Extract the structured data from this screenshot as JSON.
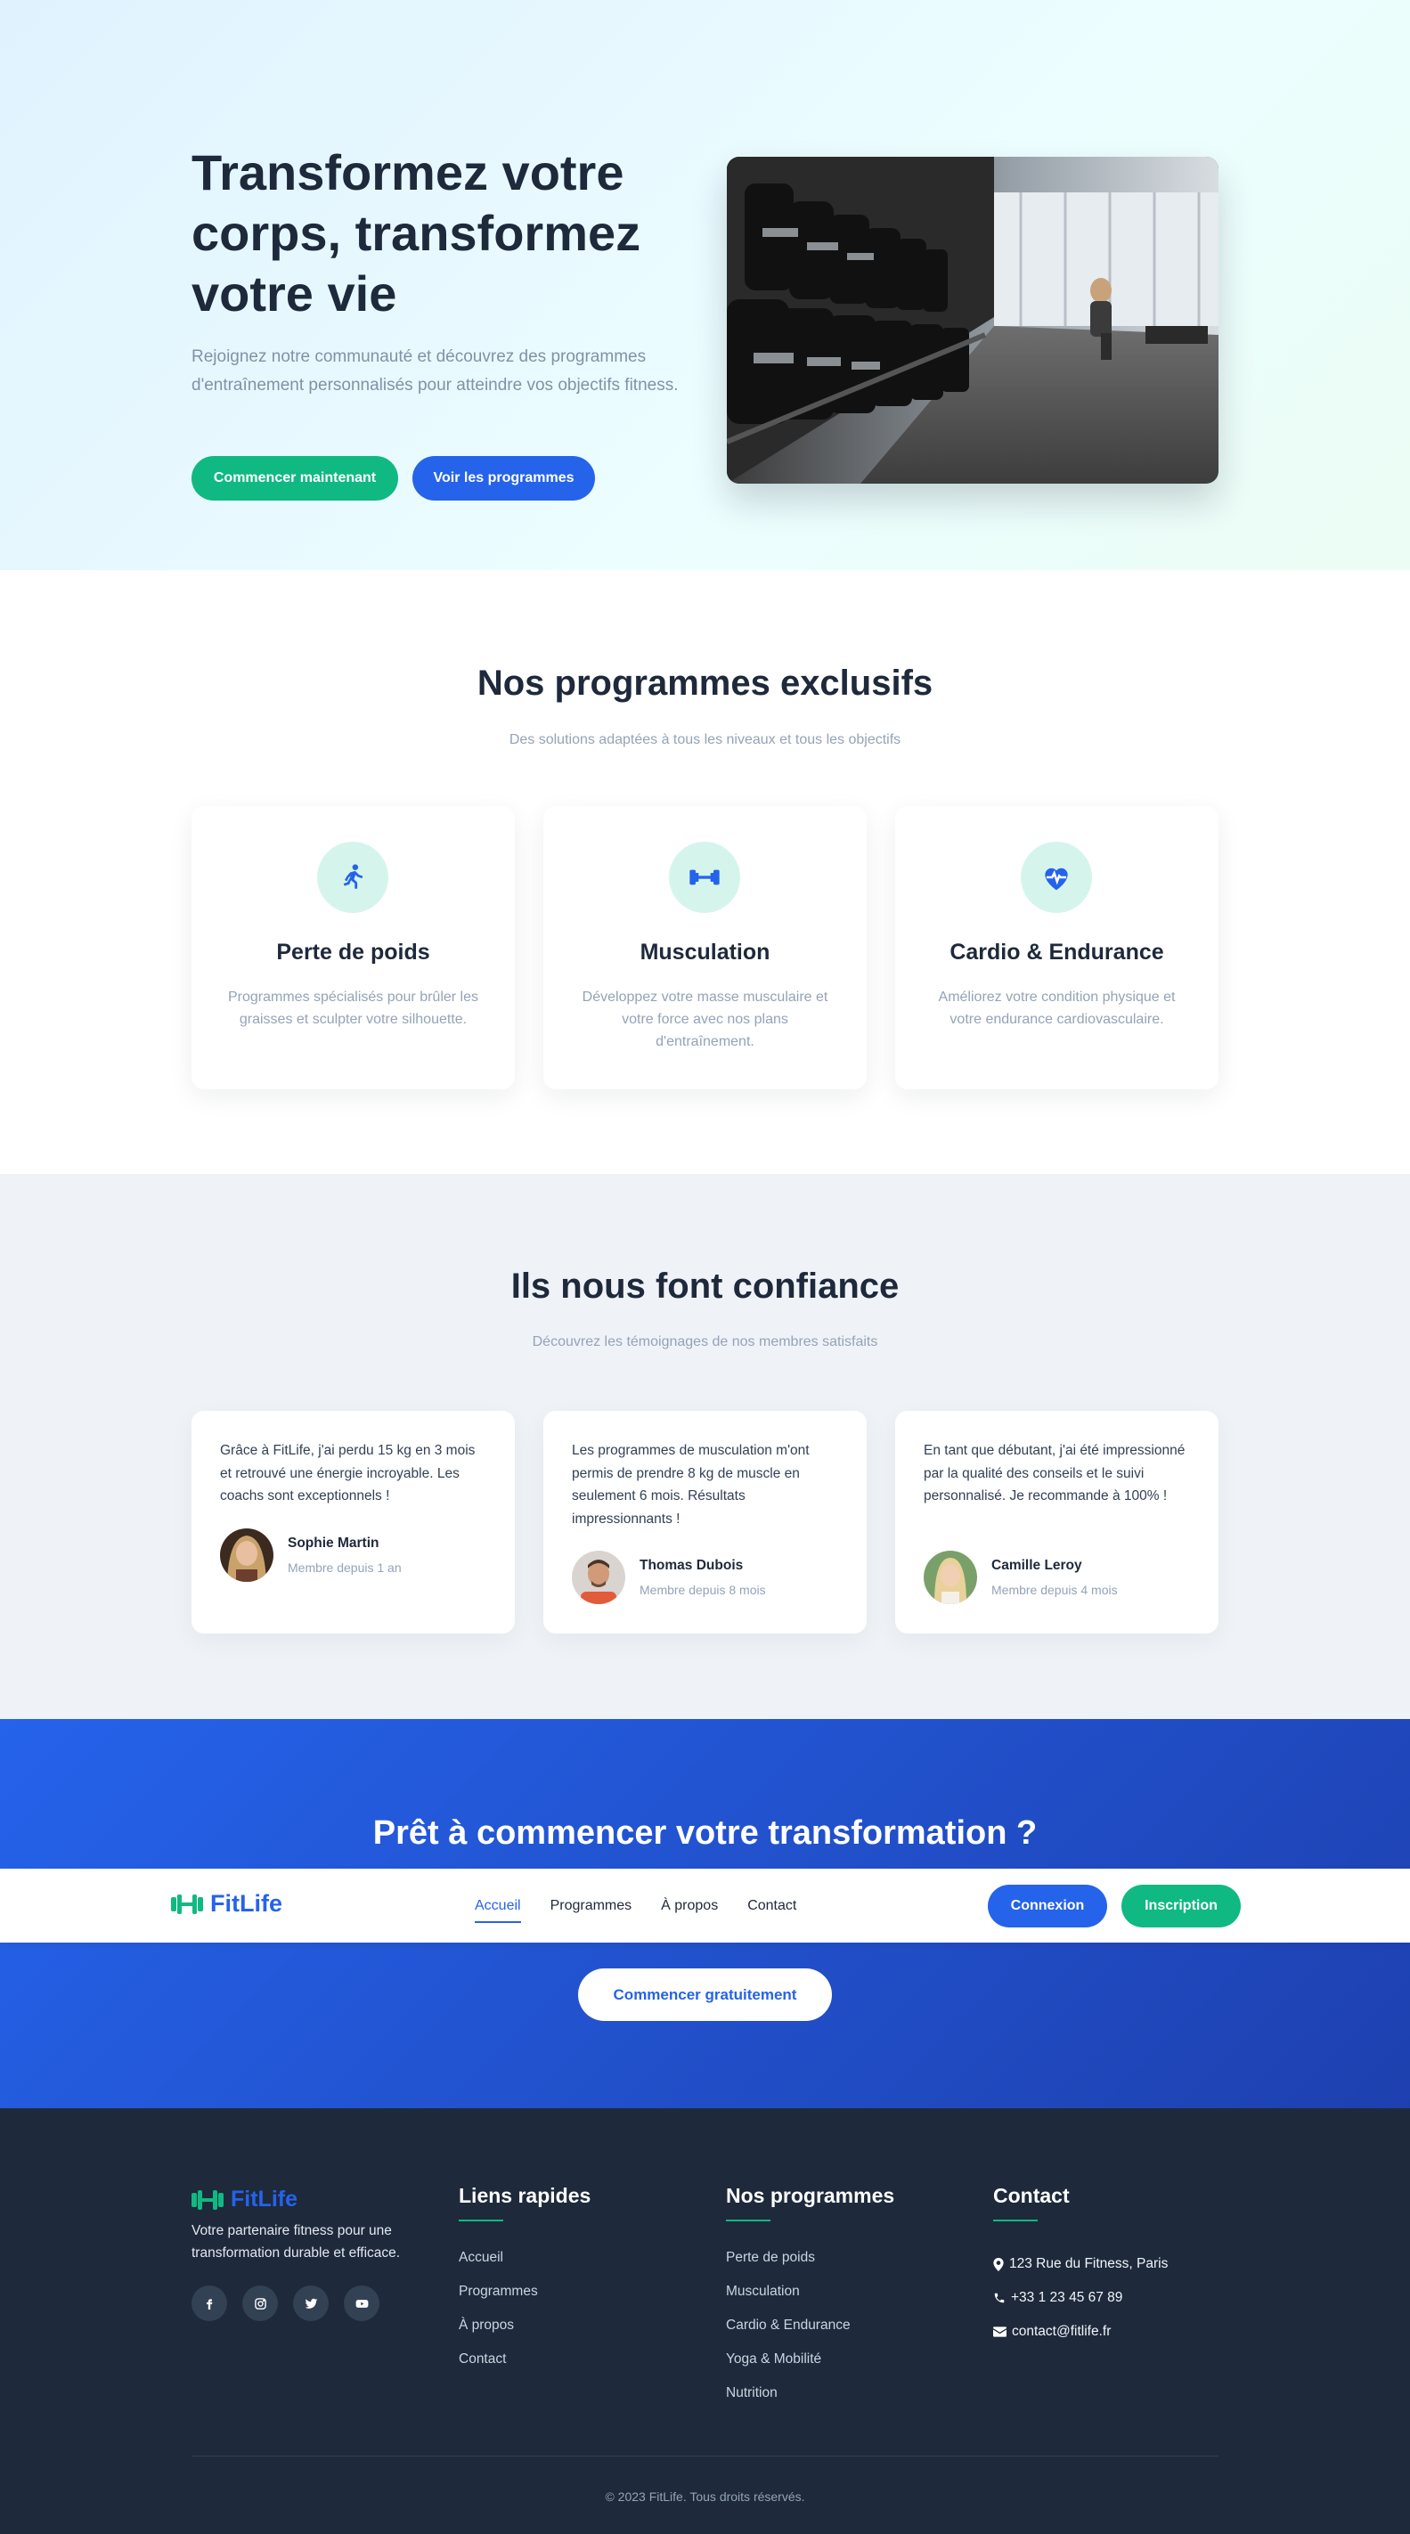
{
  "hero": {
    "title": "Transformez votre corps, transformez votre vie",
    "subtitle": "Rejoignez notre communauté et découvrez des programmes d'entraînement personnalisés pour atteindre vos objectifs fitness.",
    "primary_button": "Commencer maintenant",
    "secondary_button": "Voir les programmes"
  },
  "programs": {
    "title": "Nos programmes exclusifs",
    "subtitle": "Des solutions adaptées à tous les niveaux et tous les objectifs",
    "cards": [
      {
        "icon": "running-icon",
        "title": "Perte de poids",
        "description": "Programmes spécialisés pour brûler les graisses et sculpter votre silhouette."
      },
      {
        "icon": "dumbbell-icon",
        "title": "Musculation",
        "description": "Développez votre masse musculaire et votre force avec nos plans d'entraînement."
      },
      {
        "icon": "heartbeat-icon",
        "title": "Cardio & Endurance",
        "description": "Améliorez votre condition physique et votre endurance cardiovasculaire."
      }
    ]
  },
  "testimonials": {
    "title": "Ils nous font confiance",
    "subtitle": "Découvrez les témoignages de nos membres satisfaits",
    "items": [
      {
        "quote": "Grâce à FitLife, j'ai perdu 15 kg en 3 mois et retrouvé une énergie incroyable. Les coachs sont exceptionnels !",
        "name": "Sophie Martin",
        "since": "Membre depuis 1 an"
      },
      {
        "quote": "Les programmes de musculation m'ont permis de prendre 8 kg de muscle en seulement 6 mois. Résultats impressionnants !",
        "name": "Thomas Dubois",
        "since": "Membre depuis 8 mois"
      },
      {
        "quote": "En tant que débutant, j'ai été impressionné par la qualité des conseils et le suivi personnalisé. Je recommande à 100% !",
        "name": "Camille Leroy",
        "since": "Membre depuis 4 mois"
      }
    ]
  },
  "cta": {
    "title": "Prêt à commencer votre transformation ?",
    "button": "Commencer gratuitement"
  },
  "navbar": {
    "brand": "FitLife",
    "links": [
      "Accueil",
      "Programmes",
      "À propos",
      "Contact"
    ],
    "active": "Accueil",
    "login": "Connexion",
    "signup": "Inscription"
  },
  "footer": {
    "brand": "FitLife",
    "description": "Votre partenaire fitness pour une transformation durable et efficace.",
    "social_icons": [
      "facebook-icon",
      "instagram-icon",
      "twitter-icon",
      "youtube-icon"
    ],
    "quick_links": {
      "title": "Liens rapides",
      "items": [
        "Accueil",
        "Programmes",
        "À propos",
        "Contact"
      ]
    },
    "programs": {
      "title": "Nos programmes",
      "items": [
        "Perte de poids",
        "Musculation",
        "Cardio & Endurance",
        "Yoga & Mobilité",
        "Nutrition"
      ]
    },
    "contact": {
      "title": "Contact",
      "address": "123 Rue du Fitness, Paris",
      "phone": "+33 1 23 45 67 89",
      "email": "contact@fitlife.fr"
    },
    "copyright": "© 2023 FitLife. Tous droits réservés."
  },
  "colors": {
    "primary": "#2563eb",
    "accent": "#10b981",
    "dark": "#1e293b",
    "muted": "#94a3b8"
  }
}
